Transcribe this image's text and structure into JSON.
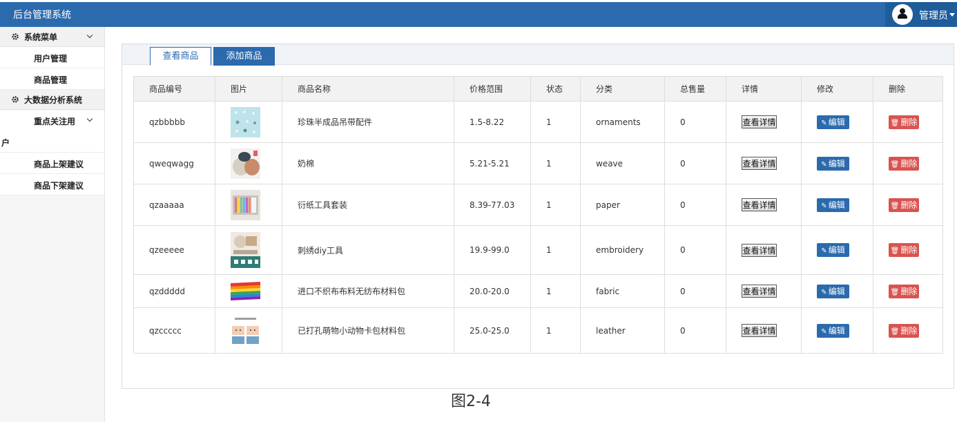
{
  "header": {
    "app_title": "后台管理系统",
    "user_name": "管理员"
  },
  "sidebar": {
    "group1_label": "系统菜单",
    "items_group1": [
      "用户管理",
      "商品管理"
    ],
    "group2_label": "大数据分析系统",
    "focus_line1": "重点关注用",
    "focus_line2": "户",
    "items_group2": [
      "商品上架建议",
      "商品下架建议"
    ]
  },
  "tabs": {
    "view_label": "查看商品",
    "add_label": "添加商品"
  },
  "table": {
    "columns": [
      "商品编号",
      "图片",
      "商品名称",
      "价格范围",
      "状态",
      "分类",
      "总售量",
      "详情",
      "修改",
      "删除"
    ],
    "detail_label": "查看详情",
    "edit_label": "编辑",
    "delete_label": "删除",
    "rows": [
      {
        "id": "qzbbbbb",
        "name": "珍珠半成品吊带配件",
        "price": "1.5-8.22",
        "status": "1",
        "category": "ornaments",
        "sales": "0",
        "thumb": "ornaments-thumb"
      },
      {
        "id": "qweqwagg",
        "name": "奶棉",
        "price": "5.21-5.21",
        "status": "1",
        "category": "weave",
        "sales": "0",
        "thumb": "yarn-thumb"
      },
      {
        "id": "qzaaaaa",
        "name": "衍纸工具套装",
        "price": "8.39-77.03",
        "status": "1",
        "category": "paper",
        "sales": "0",
        "thumb": "paper-thumb"
      },
      {
        "id": "qzeeeee",
        "name": "刺绣diy工具",
        "price": "19.9-99.0",
        "status": "1",
        "category": "embroidery",
        "sales": "0",
        "thumb": "embroidery-thumb"
      },
      {
        "id": "qzddddd",
        "name": "进口不织布布料无纺布材料包",
        "price": "20.0-20.0",
        "status": "1",
        "category": "fabric",
        "sales": "0",
        "thumb": "fabric-thumb"
      },
      {
        "id": "qzccccc",
        "name": "已打孔萌物小动物卡包材料包",
        "price": "25.0-25.0",
        "status": "1",
        "category": "leather",
        "sales": "0",
        "thumb": "leather-thumb"
      }
    ]
  },
  "caption": "图2-4",
  "colors": {
    "primary": "#2b6aad",
    "danger": "#d9534f"
  }
}
